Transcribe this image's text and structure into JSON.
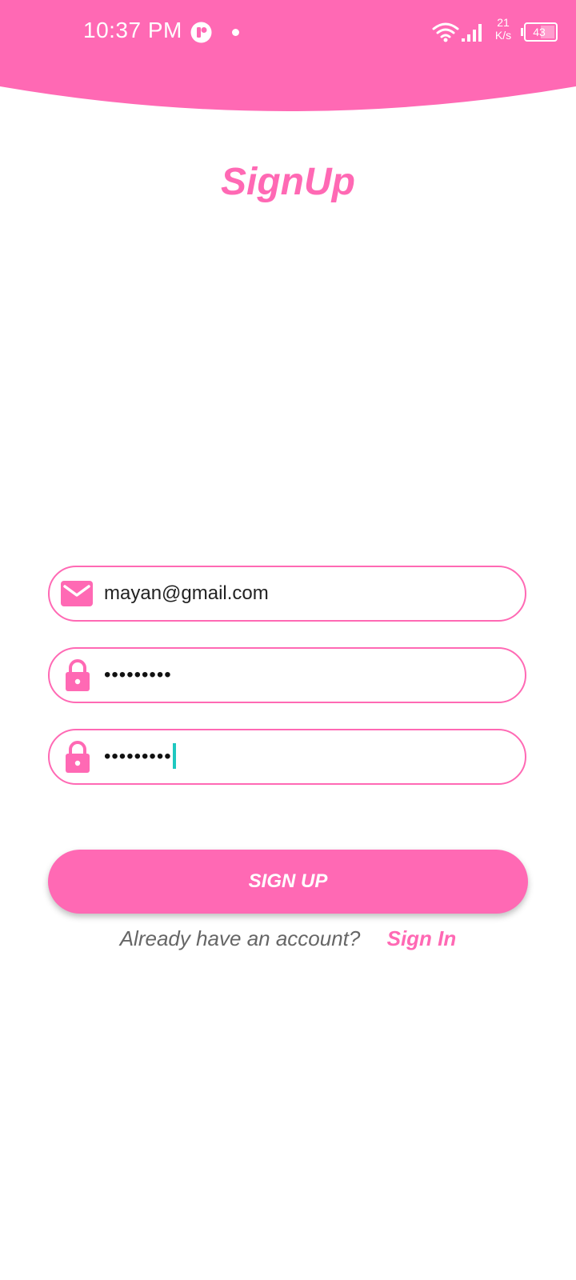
{
  "status_bar": {
    "time": "10:37 PM",
    "network_speed_value": "21",
    "network_speed_unit": "K/s",
    "battery_level": "43"
  },
  "page": {
    "title": "SignUp"
  },
  "form": {
    "email_value": "mayan@gmail.com",
    "password_value": "•••••••••",
    "confirm_password_value": "•••••••••",
    "email_icon": "envelope-icon",
    "password_icon": "lock-icon",
    "confirm_password_icon": "lock-icon"
  },
  "actions": {
    "signup_label": "SIGN UP",
    "account_prompt": "Already have an account?",
    "signin_label": "Sign In"
  },
  "colors": {
    "brand": "#ff69b4",
    "caret": "#1ec8c0"
  }
}
